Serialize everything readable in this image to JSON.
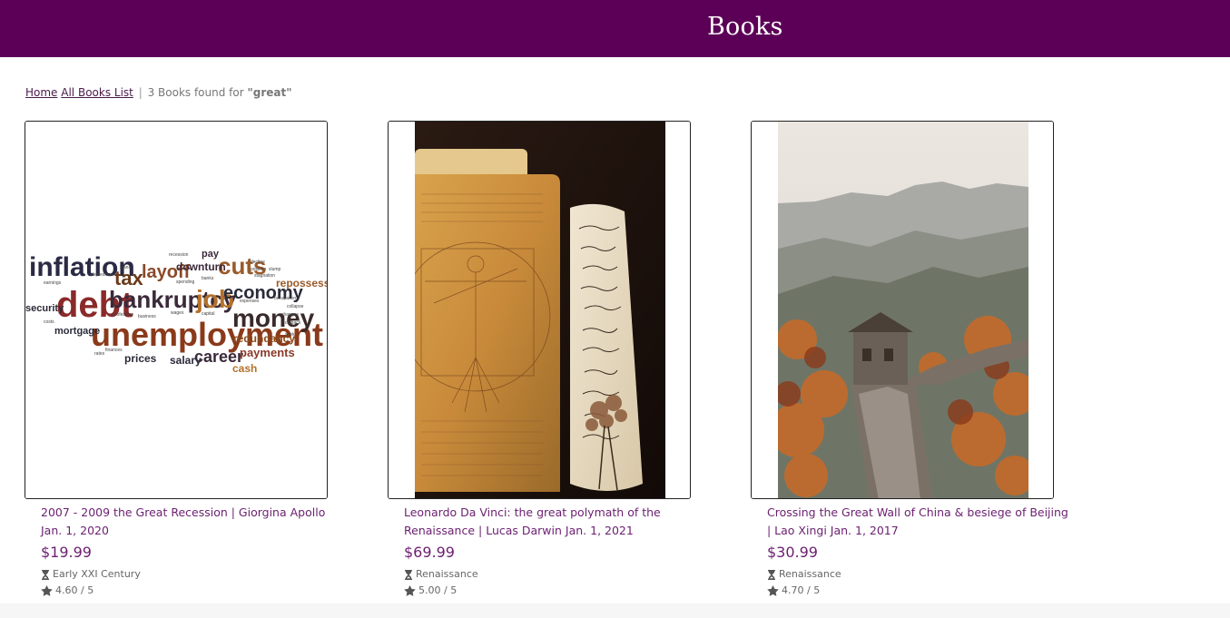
{
  "header": {
    "title": "Books"
  },
  "breadcrumb": {
    "home": "Home",
    "all_books": "All Books List",
    "separator": "|",
    "result_text": "3 Books found for",
    "query": "\"great\""
  },
  "books": [
    {
      "title": "2007 - 2009 the Great Recession | Giorgina Apollo Jan. 1, 2020",
      "price": "$19.99",
      "category": "Early XXI Century",
      "rating": "4.60 / 5",
      "cover_words": [
        "inflation",
        "debt",
        "bankruptcy",
        "job",
        "unemployment",
        "money",
        "economy",
        "cuts",
        "layoff",
        "tax",
        "mortgage",
        "security",
        "career",
        "payments",
        "redundancy",
        "salary",
        "prices",
        "cash",
        "repossession",
        "downturn",
        "pay"
      ]
    },
    {
      "title": "Leonardo Da Vinci: the great polymath of the Renaissance | Lucas Darwin Jan. 1, 2021",
      "price": "$69.99",
      "category": "Renaissance",
      "rating": "5.00 / 5"
    },
    {
      "title": "Crossing the Great Wall of China & besiege of Beijing | Lao Xingi Jan. 1, 2017",
      "price": "$30.99",
      "category": "Renaissance",
      "rating": "4.70 / 5"
    }
  ],
  "colors": {
    "header_bg": "#5b0056",
    "accent": "#6b1f70"
  }
}
